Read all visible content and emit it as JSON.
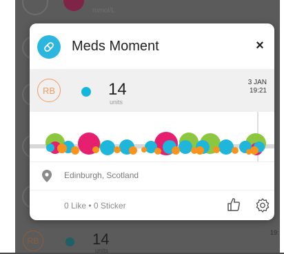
{
  "background": {
    "top_unit": "mmol/L",
    "bottom_avatar": "RB",
    "bottom_value": "14",
    "bottom_unit": "units",
    "bottom_time": "19:"
  },
  "card": {
    "title": "Meds Moment",
    "close_label": "×",
    "entry": {
      "avatar_initials": "RB",
      "value": "14",
      "unit": "units",
      "date": "3 JAN",
      "time": "19:21"
    },
    "location": "Edinburgh, Scotland",
    "social": "0 Like • 0 Sticker"
  },
  "colors": {
    "accent": "#2bb6e0",
    "avatar_ring": "#f29a61",
    "timeline_green": "#8dc63f",
    "timeline_pink": "#e6206f",
    "timeline_blue": "#1fb6dc",
    "timeline_orange": "#f7941d"
  },
  "icons": {
    "app": "pill-icon",
    "location": "pin-icon",
    "like": "thumbs-up-icon",
    "settings": "gear-icon"
  }
}
